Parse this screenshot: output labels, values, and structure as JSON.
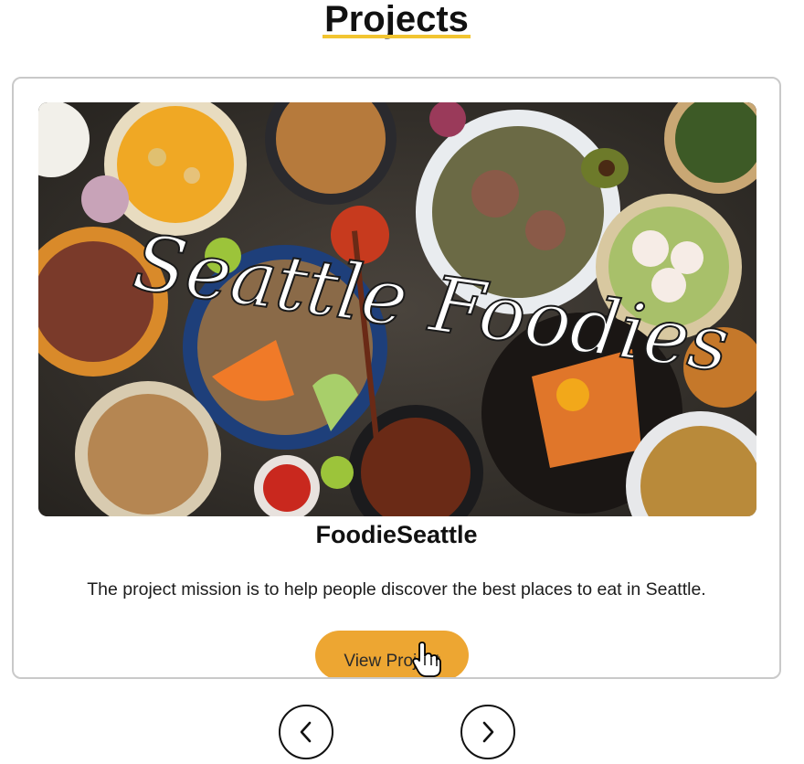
{
  "section": {
    "title": "Projects"
  },
  "project": {
    "image_caption": "Seattle Foodies",
    "name": "FoodieSeattle",
    "description": "The project mission is to help people discover the best places to eat in Seattle.",
    "button_label": "View Project"
  },
  "carousel": {
    "prev_icon": "chevron-left-icon",
    "next_icon": "chevron-right-icon"
  },
  "colors": {
    "accent": "#eda632",
    "title_underline": "#f2c531",
    "card_border": "#c9c9c9"
  }
}
